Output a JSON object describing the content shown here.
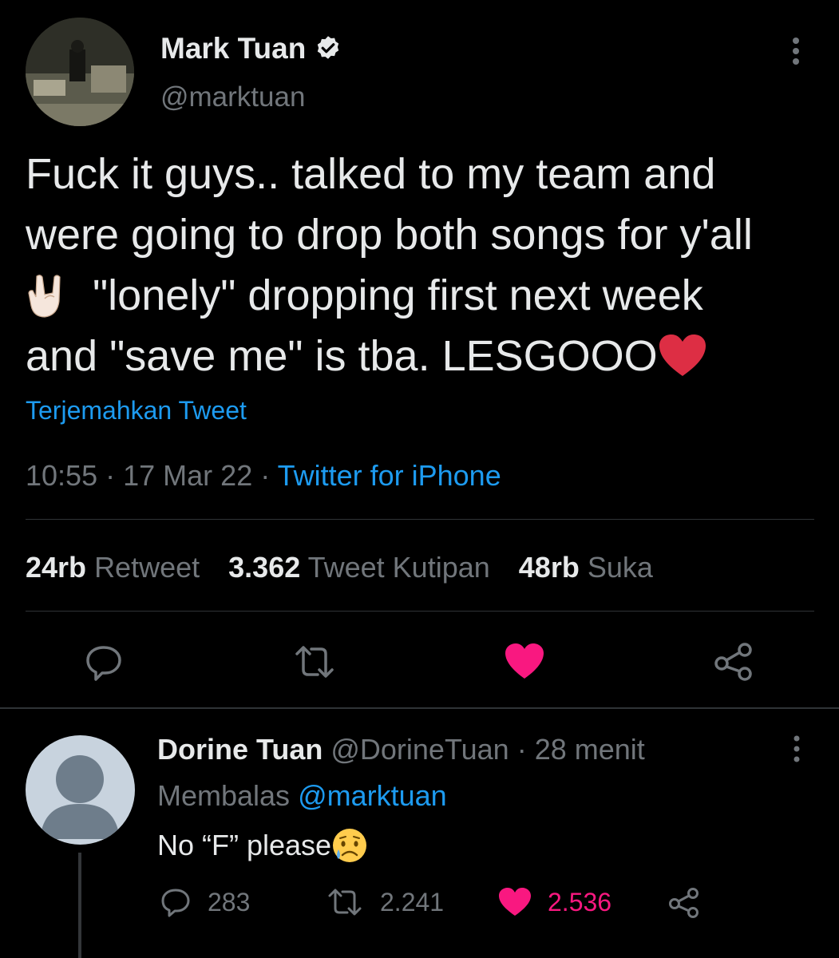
{
  "tweet": {
    "author_name": "Mark Tuan",
    "author_handle": "@marktuan",
    "text_lines": [
      "Fuck it guys.. talked to my team and",
      "were going to drop both songs for y'all",
      "\"lonely\" dropping first next week",
      "and \"save me\" is tba. LESGOOO"
    ],
    "translate_label": "Terjemahkan Tweet",
    "time": "10:55",
    "date": "17 Mar 22",
    "separator": "·",
    "source": "Twitter for iPhone",
    "stats": {
      "retweets_count": "24rb",
      "retweets_label": "Retweet",
      "quotes_count": "3.362",
      "quotes_label": "Tweet Kutipan",
      "likes_count": "48rb",
      "likes_label": "Suka"
    }
  },
  "reply": {
    "author_name": "Dorine Tuan",
    "author_handle": "@DorineTuan",
    "separator": "·",
    "time_ago": "28 menit",
    "replying_to_label": "Membalas",
    "replying_to_handle": "@marktuan",
    "text": "No “F” please",
    "replies_count": "283",
    "retweets_count": "2.241",
    "likes_count": "2.536"
  },
  "colors": {
    "background": "#000000",
    "text": "#e7e9ea",
    "muted": "#71767b",
    "link": "#1d9bf0",
    "like": "#f91880",
    "heart_emoji": "#dd2e44"
  },
  "icons": [
    "verified-badge-icon",
    "more-icon",
    "reply-icon",
    "retweet-icon",
    "like-icon",
    "share-icon",
    "rock-hand-emoji",
    "heart-emoji",
    "sad-face-emoji",
    "default-avatar-icon"
  ]
}
